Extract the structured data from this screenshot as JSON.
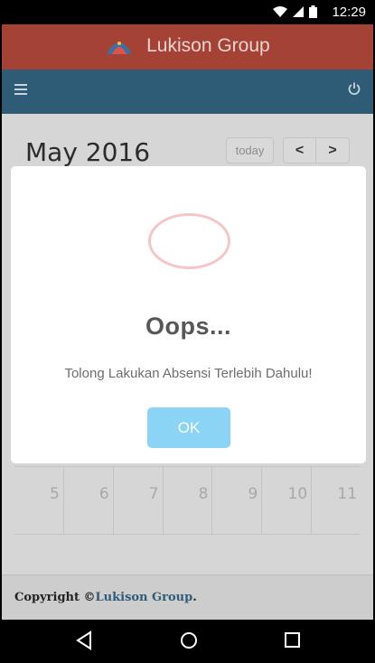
{
  "status_bar": {
    "time": "12:29"
  },
  "app_bar": {
    "brand": "Lukison Group"
  },
  "calendar": {
    "title": "May 2016",
    "today_label": "today",
    "prev_label": "<",
    "next_label": ">",
    "visible_week": [
      "5",
      "6",
      "7",
      "8",
      "9",
      "10",
      "11"
    ]
  },
  "footer": {
    "copyright_prefix": "Copyright ©",
    "company": "Lukison Group",
    "suffix": "."
  },
  "modal": {
    "title": "Oops...",
    "message": "Tolong Lakukan Absensi Terlebih Dahulu!",
    "ok_label": "OK"
  },
  "colors": {
    "app_bar": "#a54236",
    "nav_bar": "#2e5c76",
    "ok_button": "#8cd4f5",
    "error_ring": "#f5c6c6"
  }
}
